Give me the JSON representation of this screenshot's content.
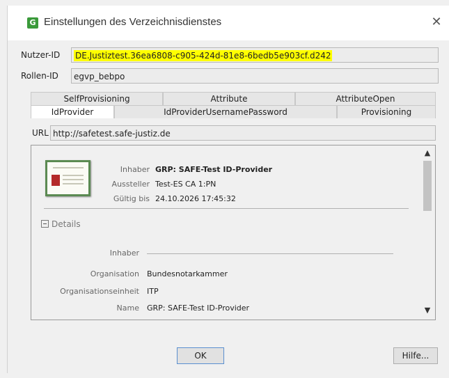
{
  "window": {
    "app_icon": "G",
    "title": "Einstellungen des Verzeichnisdienstes",
    "close_icon": "close-icon"
  },
  "fields": {
    "nutzer_label": "Nutzer-ID",
    "nutzer_value": "DE.Justiztest.36ea6808-c905-424d-81e8-6bedb5e903cf.d242",
    "rollen_label": "Rollen-ID",
    "rollen_value": "egvp_bebpo"
  },
  "tabs": {
    "row1": [
      "SelfProvisioning",
      "Attribute",
      "AttributeOpen"
    ],
    "row2": [
      "IdProvider",
      "IdProviderUsernamePassword",
      "Provisioning"
    ],
    "active": "IdProvider"
  },
  "url": {
    "label": "URL",
    "value": "http://safetest.safe-justiz.de"
  },
  "certificate": {
    "inhaber_label": "Inhaber",
    "inhaber_value": "GRP: SAFE-Test ID-Provider",
    "aussteller_label": "Aussteller",
    "aussteller_value": "Test-ES CA 1:PN",
    "gueltig_label": "Gültig bis",
    "gueltig_value": "24.10.2026 17:45:32"
  },
  "details": {
    "toggle_label": "Details",
    "section_inhaber": "Inhaber",
    "organisation_label": "Organisation",
    "organisation_value": "Bundesnotarkammer",
    "orgeinheit_label": "Organisationseinheit",
    "orgeinheit_value": "ITP",
    "name_label": "Name",
    "name_value": "GRP: SAFE-Test ID-Provider"
  },
  "buttons": {
    "ok": "OK",
    "help": "Hilfe..."
  },
  "colors": {
    "highlight": "#ffff00",
    "app_icon_bg": "#3a9a3a"
  }
}
